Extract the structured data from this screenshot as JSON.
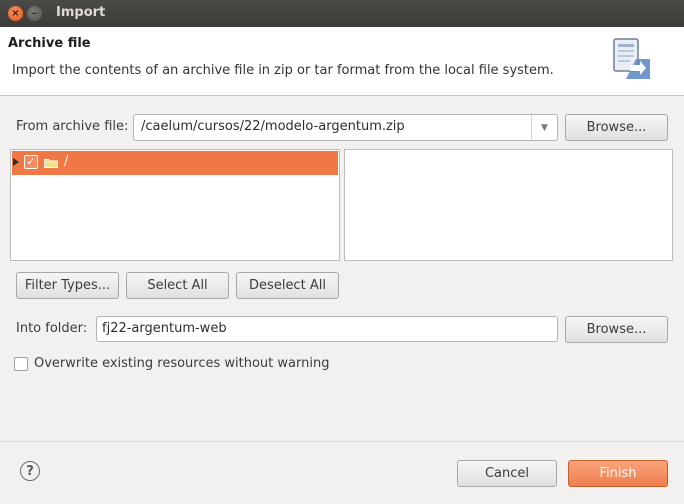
{
  "window": {
    "title": "Import",
    "close_glyph": "×",
    "minimize_glyph": "–"
  },
  "header": {
    "title": "Archive file",
    "description": "Import the contents of an archive file in zip or tar format from the local file system.",
    "icon": "archive-import-icon"
  },
  "archive": {
    "label": "From archive file:",
    "value": "/caelum/cursos/22/modelo-argentum.zip",
    "dropdown_glyph": "▼",
    "browse_label": "Browse..."
  },
  "tree": {
    "items": [
      {
        "label": "/",
        "checked": true,
        "expanded": false,
        "selected": true
      }
    ],
    "check_glyph": "✓"
  },
  "selection_buttons": {
    "filter_types": "Filter Types...",
    "select_all": "Select All",
    "deselect_all": "Deselect All"
  },
  "into_folder": {
    "label": "Into folder:",
    "value": "fj22-argentum-web",
    "browse_label": "Browse..."
  },
  "overwrite": {
    "label": "Overwrite existing resources without warning",
    "checked": false
  },
  "footer": {
    "help_glyph": "?",
    "cancel_label": "Cancel",
    "finish_label": "Finish"
  },
  "colors": {
    "accent": "#f07746",
    "titlebar": "#3c3b37",
    "dialog_bg": "#f2f1f0"
  }
}
